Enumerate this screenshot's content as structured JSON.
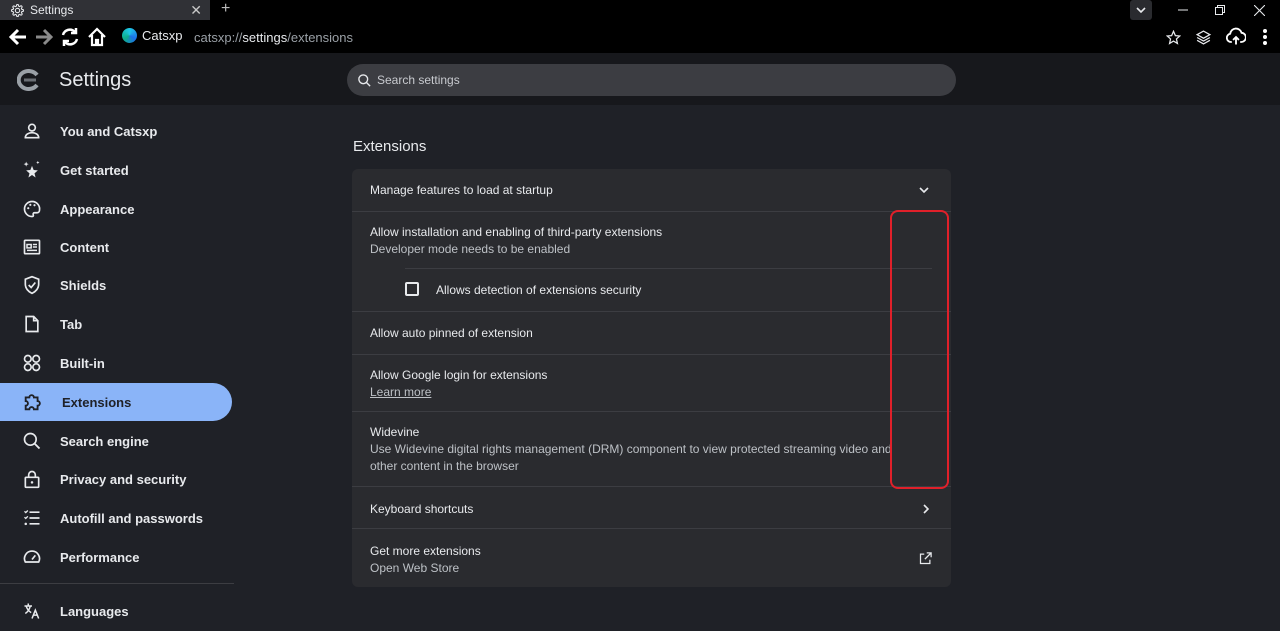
{
  "browser": {
    "tab_title": "Settings",
    "tab_close": "✕",
    "new_tab": "+",
    "site_name": "Catsxp",
    "url_scheme": "catsxp://",
    "url_host": "settings",
    "url_path": "/extensions"
  },
  "header": {
    "title": "Settings",
    "search_placeholder": "Search settings"
  },
  "sidebar": {
    "items": [
      {
        "label": "You and Catsxp",
        "icon": "person-icon"
      },
      {
        "label": "Get started",
        "icon": "sparkle-star-icon"
      },
      {
        "label": "Appearance",
        "icon": "palette-icon"
      },
      {
        "label": "Content",
        "icon": "content-icon"
      },
      {
        "label": "Shields",
        "icon": "shield-icon"
      },
      {
        "label": "Tab",
        "icon": "tab-icon"
      },
      {
        "label": "Built-in",
        "icon": "grid-icon"
      },
      {
        "label": "Extensions",
        "icon": "puzzle-icon",
        "active": true
      },
      {
        "label": "Search engine",
        "icon": "search-icon"
      },
      {
        "label": "Privacy and security",
        "icon": "lock-icon"
      },
      {
        "label": "Autofill and passwords",
        "icon": "list-icon"
      },
      {
        "label": "Performance",
        "icon": "speedometer-icon"
      },
      {
        "label": "Languages",
        "icon": "translate-icon"
      }
    ]
  },
  "main": {
    "section_title": "Extensions",
    "rows": {
      "manage_features": "Manage features to load at startup",
      "third_party_title": "Allow installation and enabling of third-party extensions",
      "third_party_sub": "Developer mode needs to be enabled",
      "detection_label": "Allows detection of extensions security",
      "auto_pinned": "Allow auto pinned of extension",
      "google_login_title": "Allow Google login for extensions",
      "google_login_link": "Learn more",
      "widevine_title": "Widevine",
      "widevine_sub": "Use Widevine digital rights management (DRM) component to view protected streaming video and other content in the browser",
      "keyboard_shortcuts": "Keyboard shortcuts",
      "get_more_title": "Get more extensions",
      "get_more_sub": "Open Web Store"
    }
  },
  "colors": {
    "accent": "#8ab4f8",
    "highlight_box": "#e0202a",
    "card_bg": "#2a2b2f",
    "page_bg": "#1f2127"
  }
}
